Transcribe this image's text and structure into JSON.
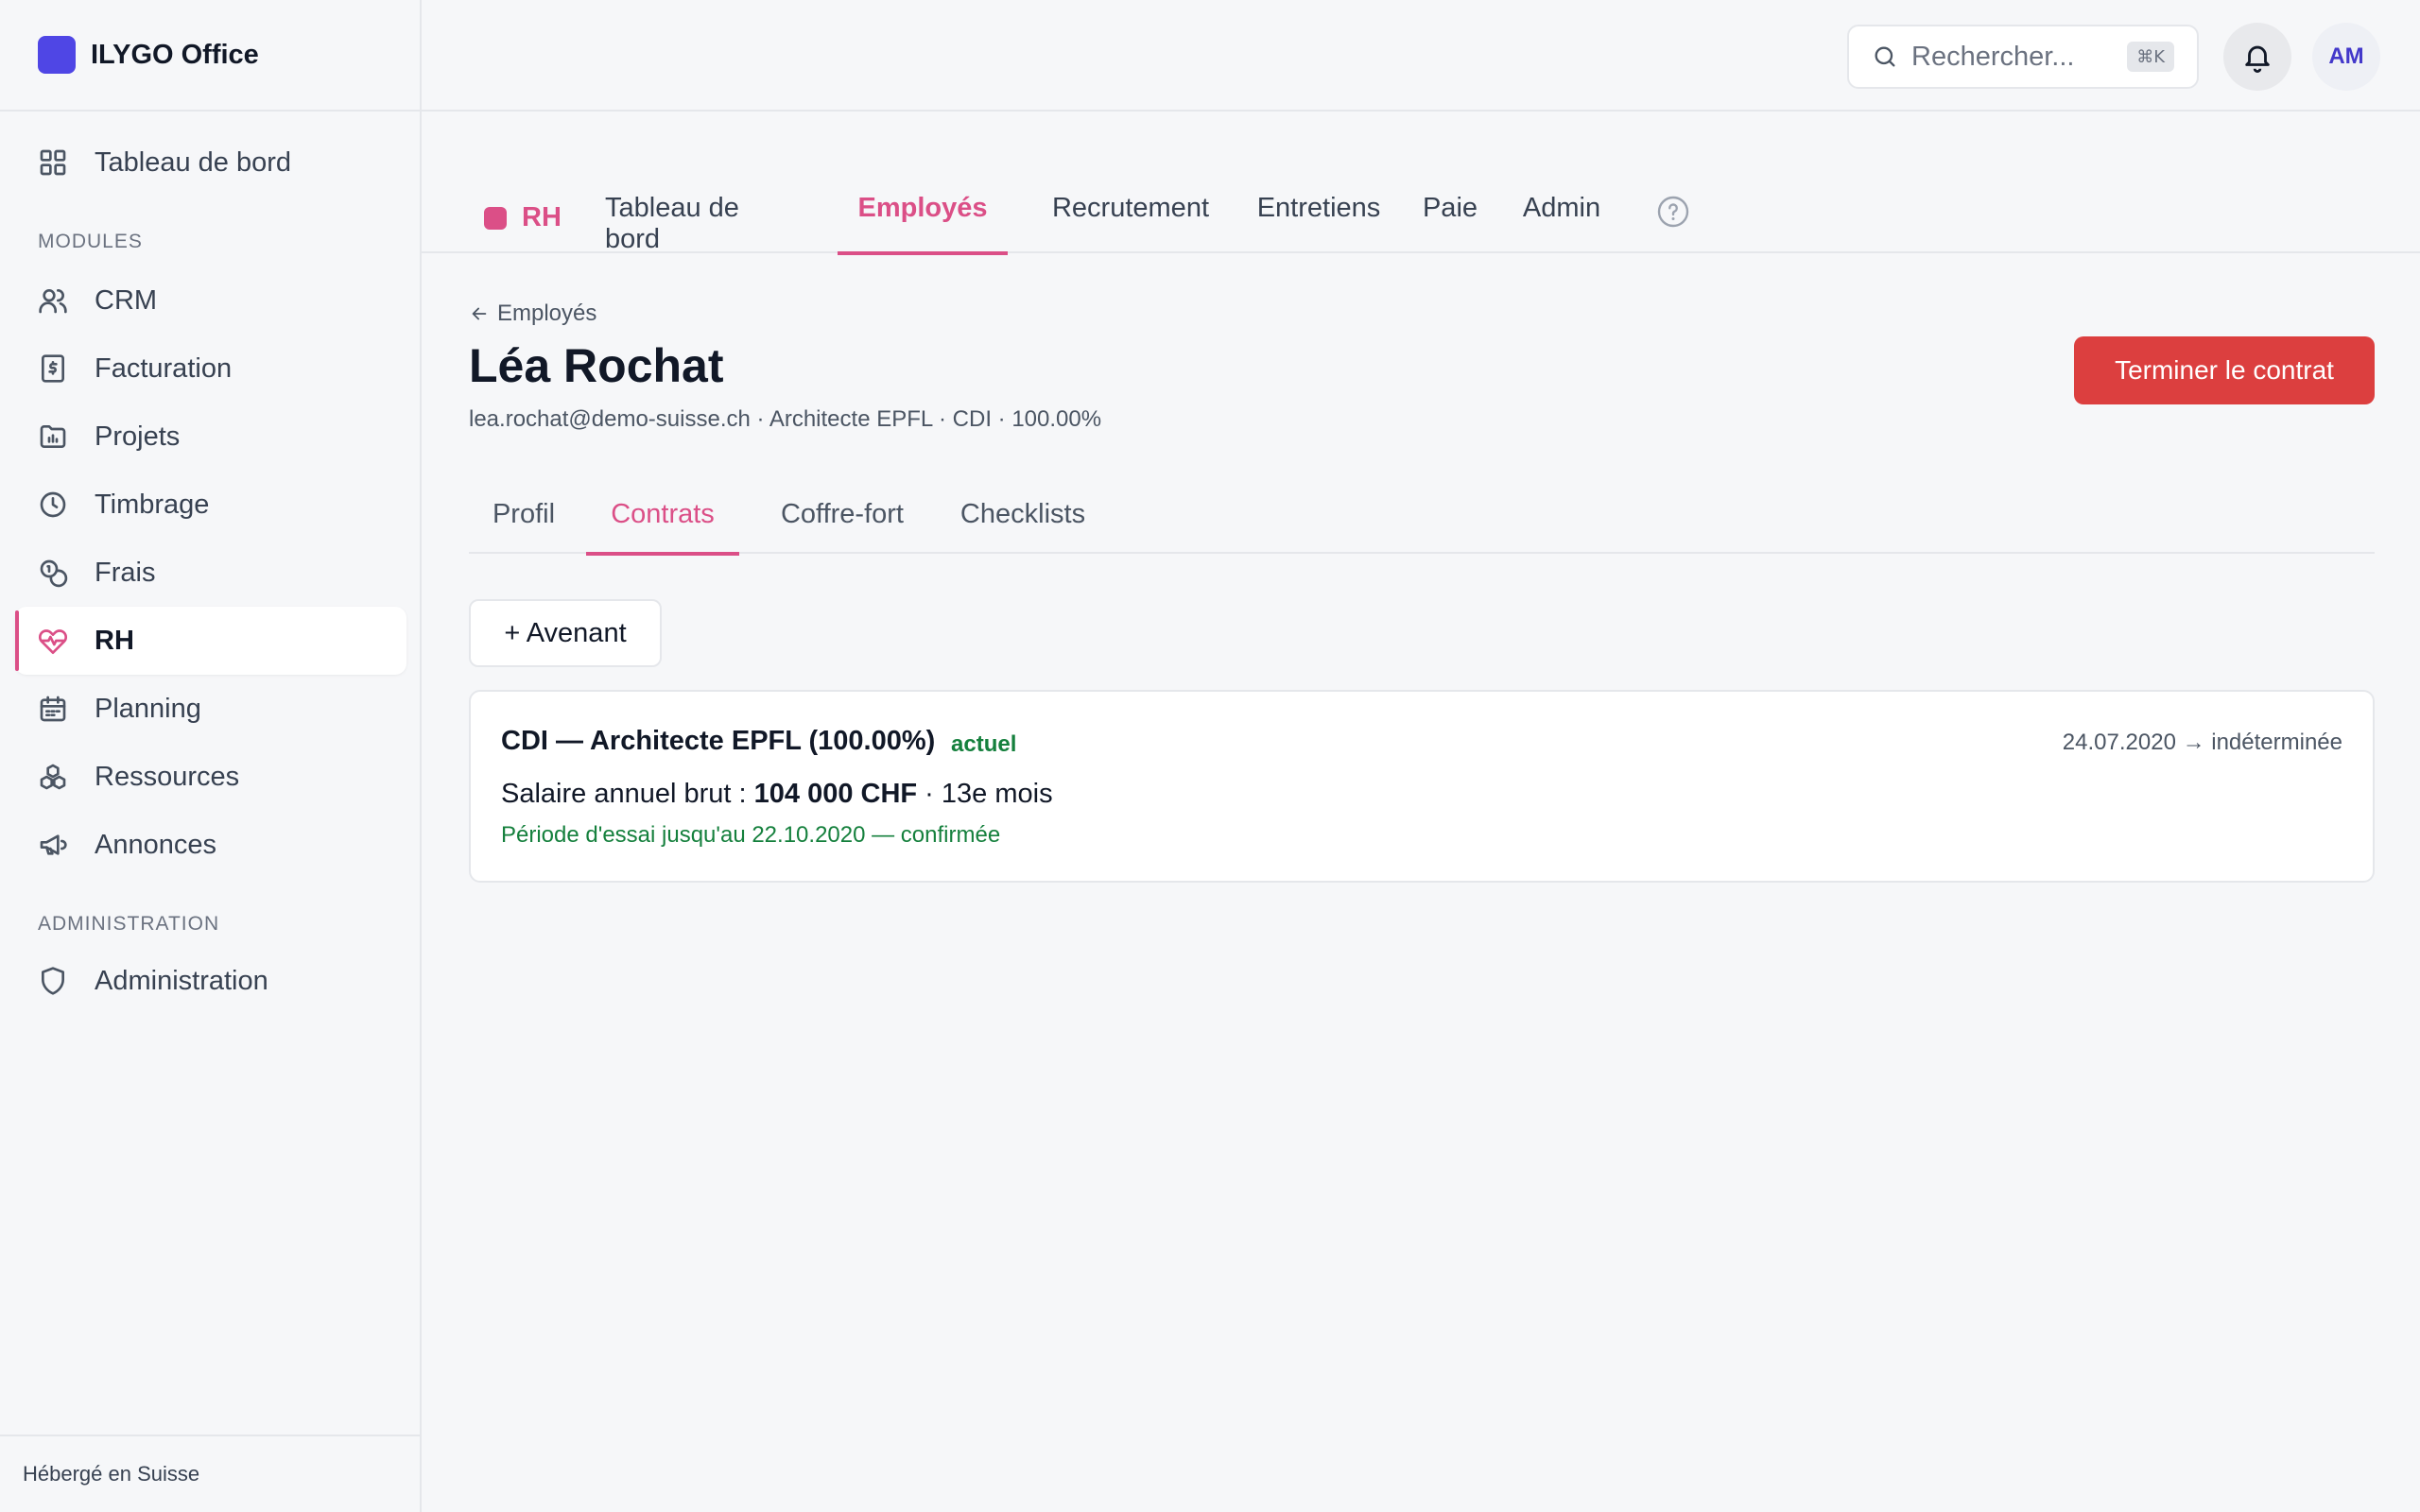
{
  "app": {
    "name": "ILYGO Office"
  },
  "sidebar": {
    "dashboard_label": "Tableau de bord",
    "modules_label": "MODULES",
    "items": [
      {
        "label": "CRM",
        "icon": "users-icon"
      },
      {
        "label": "Facturation",
        "icon": "invoice-icon"
      },
      {
        "label": "Projets",
        "icon": "folder-chart-icon"
      },
      {
        "label": "Timbrage",
        "icon": "clock-icon"
      },
      {
        "label": "Frais",
        "icon": "coins-icon"
      },
      {
        "label": "RH",
        "icon": "heart-pulse-icon",
        "active": true
      },
      {
        "label": "Planning",
        "icon": "calendar-icon"
      },
      {
        "label": "Ressources",
        "icon": "boxes-icon"
      },
      {
        "label": "Annonces",
        "icon": "megaphone-icon"
      }
    ],
    "admin_label": "ADMINISTRATION",
    "admin_item": "Administration",
    "footer": "Hébergé en Suisse"
  },
  "topbar": {
    "search_placeholder": "Rechercher...",
    "shortcut": "⌘K",
    "avatar_initials": "AM"
  },
  "module": {
    "badge": "RH",
    "color": "#db4f87",
    "tabs": [
      "Tableau de bord",
      "Employés",
      "Recrutement",
      "Entretiens",
      "Paie",
      "Admin"
    ],
    "active_tab": "Employés"
  },
  "employee": {
    "back_label": "Employés",
    "name": "Léa Rochat",
    "meta": "lea.rochat@demo-suisse.ch · Architecte EPFL · CDI · 100.00%",
    "terminate_label": "Terminer le contrat",
    "subtabs": [
      "Profil",
      "Contrats",
      "Coffre-fort",
      "Checklists"
    ],
    "active_subtab": "Contrats"
  },
  "contracts": {
    "add_label": "+ Avenant",
    "items": [
      {
        "title": "CDI — Architecte EPFL (100.00%)",
        "badge": "actuel",
        "dates": "24.07.2020 → indéterminée",
        "salary_prefix": "Salaire annuel brut : ",
        "salary_amount": "104 000 CHF",
        "salary_suffix": " · 13e mois",
        "trial": "Période d'essai jusqu'au 22.10.2020 — confirmée"
      }
    ]
  }
}
